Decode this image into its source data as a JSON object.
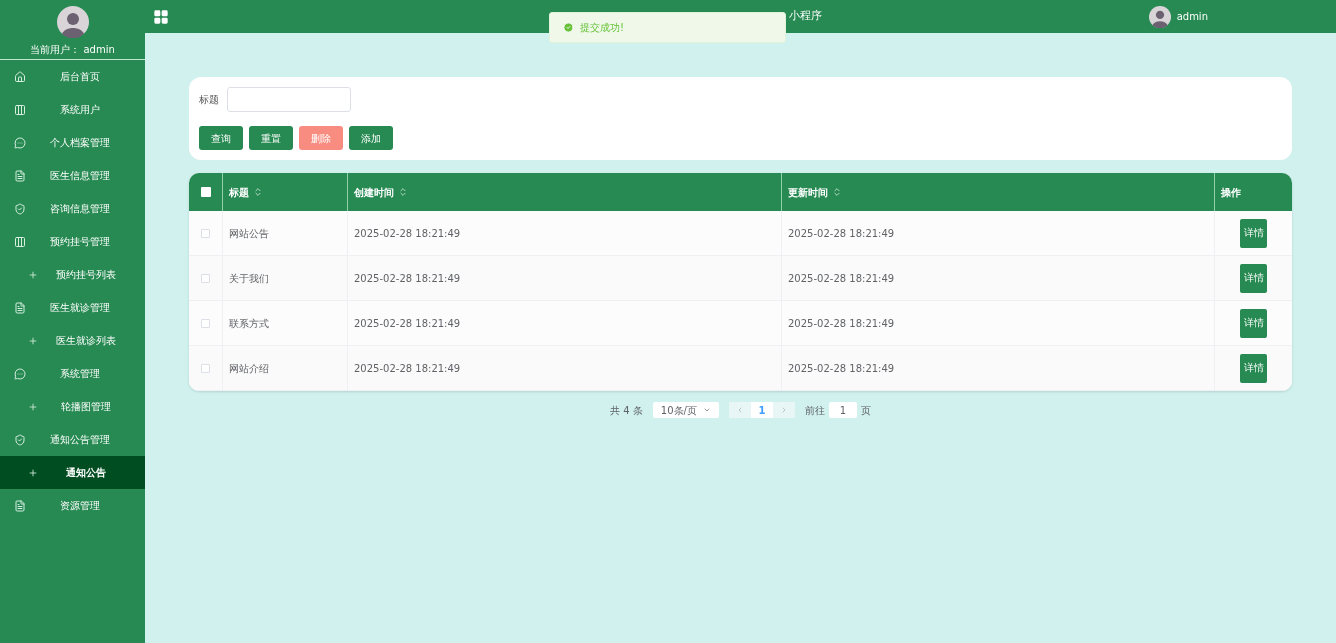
{
  "sidebar": {
    "current_user_label": "当前用户：",
    "current_user": "admin",
    "items": [
      {
        "label": "后台首页",
        "kind": "home",
        "selected": false
      },
      {
        "label": "系统用户",
        "kind": "columns",
        "selected": false
      },
      {
        "label": "个人档案管理",
        "kind": "chat",
        "selected": false
      },
      {
        "label": "医生信息管理",
        "kind": "doc",
        "selected": false
      },
      {
        "label": "咨询信息管理",
        "kind": "shield",
        "selected": false
      },
      {
        "label": "预约挂号管理",
        "kind": "columns",
        "selected": false
      },
      {
        "label": "预约挂号列表",
        "kind": "sub",
        "selected": false
      },
      {
        "label": "医生就诊管理",
        "kind": "doc",
        "selected": false
      },
      {
        "label": "医生就诊列表",
        "kind": "sub",
        "selected": false
      },
      {
        "label": "系统管理",
        "kind": "chat",
        "selected": false
      },
      {
        "label": "轮播图管理",
        "kind": "sub",
        "selected": false
      },
      {
        "label": "通知公告管理",
        "kind": "shield",
        "selected": false
      },
      {
        "label": "通知公告",
        "kind": "sub",
        "selected": true
      },
      {
        "label": "资源管理",
        "kind": "doc",
        "selected": false
      }
    ]
  },
  "header": {
    "title": "小程序",
    "user": "admin"
  },
  "toast": {
    "message": "提交成功!"
  },
  "search": {
    "label": "标题",
    "buttons": [
      {
        "label": "查询",
        "kind": "primary"
      },
      {
        "label": "重置",
        "kind": "primary"
      },
      {
        "label": "删除",
        "kind": "danger"
      },
      {
        "label": "添加",
        "kind": "primary"
      }
    ]
  },
  "table": {
    "all_checked": false,
    "columns": [
      "标题",
      "创建时间",
      "更新时间",
      "操作"
    ],
    "rows": [
      {
        "title": "网站公告",
        "created": "2025-02-28 18:21:49",
        "updated": "2025-02-28 18:21:49",
        "action": "详情",
        "checked": false
      },
      {
        "title": "关于我们",
        "created": "2025-02-28 18:21:49",
        "updated": "2025-02-28 18:21:49",
        "action": "详情",
        "checked": false
      },
      {
        "title": "联系方式",
        "created": "2025-02-28 18:21:49",
        "updated": "2025-02-28 18:21:49",
        "action": "详情",
        "checked": false
      },
      {
        "title": "网站介绍",
        "created": "2025-02-28 18:21:49",
        "updated": "2025-02-28 18:21:49",
        "action": "详情",
        "checked": false
      }
    ]
  },
  "pagination": {
    "total": "共 4 条",
    "page_size": "10条/页",
    "pages": [
      {
        "label": "1",
        "selected": true
      }
    ],
    "goto_label": "前往",
    "goto_value": "1",
    "goto_suffix": "页"
  }
}
